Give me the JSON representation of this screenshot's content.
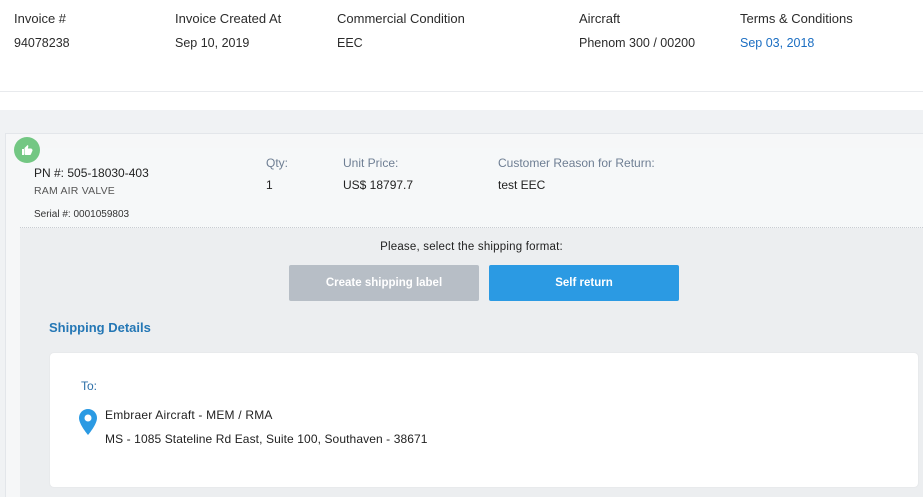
{
  "invoice": {
    "columns": [
      {
        "label": "Invoice #",
        "value": "94078238"
      },
      {
        "label": "Invoice Created At",
        "value": "Sep 10, 2019"
      },
      {
        "label": "Commercial Condition",
        "value": "EEC"
      },
      {
        "label": "Aircraft",
        "value": "Phenom 300 / 00200"
      },
      {
        "label": "Terms & Conditions",
        "value": "Sep 03, 2018"
      }
    ]
  },
  "item": {
    "status_icon": "thumbs-up-icon",
    "status_color": "#73c783",
    "pn": "PN #: 505-18030-403",
    "description": "RAM AIR VALVE",
    "serial": "Serial #: 0001059803",
    "qty_label": "Qty:",
    "qty_value": "1",
    "unit_price_label": "Unit Price:",
    "unit_price_value": "US$ 18797.7",
    "reason_label": "Customer Reason for Return:",
    "reason_value": "test EEC"
  },
  "shipping": {
    "prompt": "Please, select the shipping format:",
    "create_label_button": "Create shipping label",
    "self_return_button": "Self return",
    "details_title": "Shipping Details",
    "to_label": "To:",
    "location_icon": "map-pin-icon",
    "address_line1": "Embraer Aircraft - MEM / RMA",
    "address_line2": "MS - 1085 Stateline Rd East, Suite 100, Southaven - 38671"
  },
  "colors": {
    "link": "#1b6ec2",
    "primary_button": "#2b9ae3",
    "disabled_button": "#b7bec6",
    "section_title": "#2477b5"
  }
}
